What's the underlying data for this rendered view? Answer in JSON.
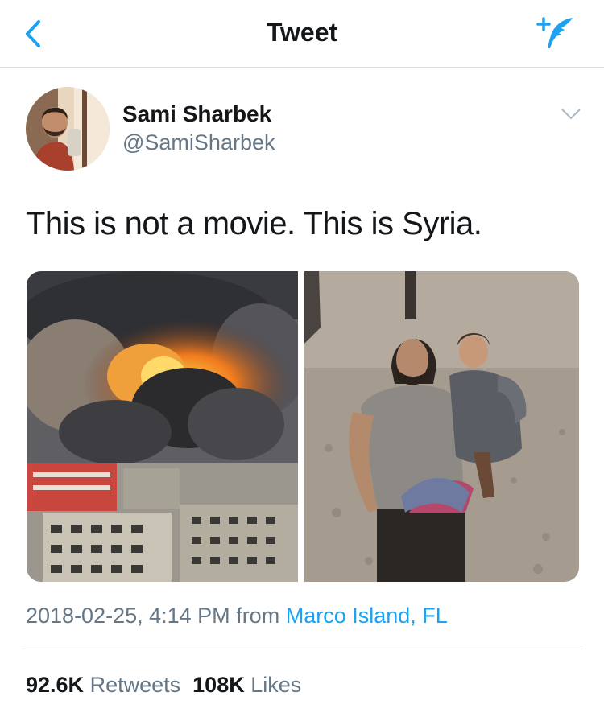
{
  "header": {
    "title": "Tweet",
    "back_icon": "chevron-left-icon",
    "compose_icon": "compose-tweet-icon"
  },
  "tweet": {
    "author_name": "Sami Sharbek",
    "author_handle": "@SamiSharbek",
    "text": "This is not a movie. This is Syria.",
    "timestamp": "2018-02-25, 4:14 PM",
    "from_label": "from",
    "location": "Marco Island, FL",
    "retweets_count": "92.6K",
    "retweets_label": "Retweets",
    "likes_count": "108K",
    "likes_label": "Likes",
    "menu_icon": "chevron-down-icon"
  },
  "colors": {
    "accent": "#1da1f2",
    "text_primary": "#14171a",
    "text_secondary": "#657786",
    "divider": "#d8dde2"
  }
}
